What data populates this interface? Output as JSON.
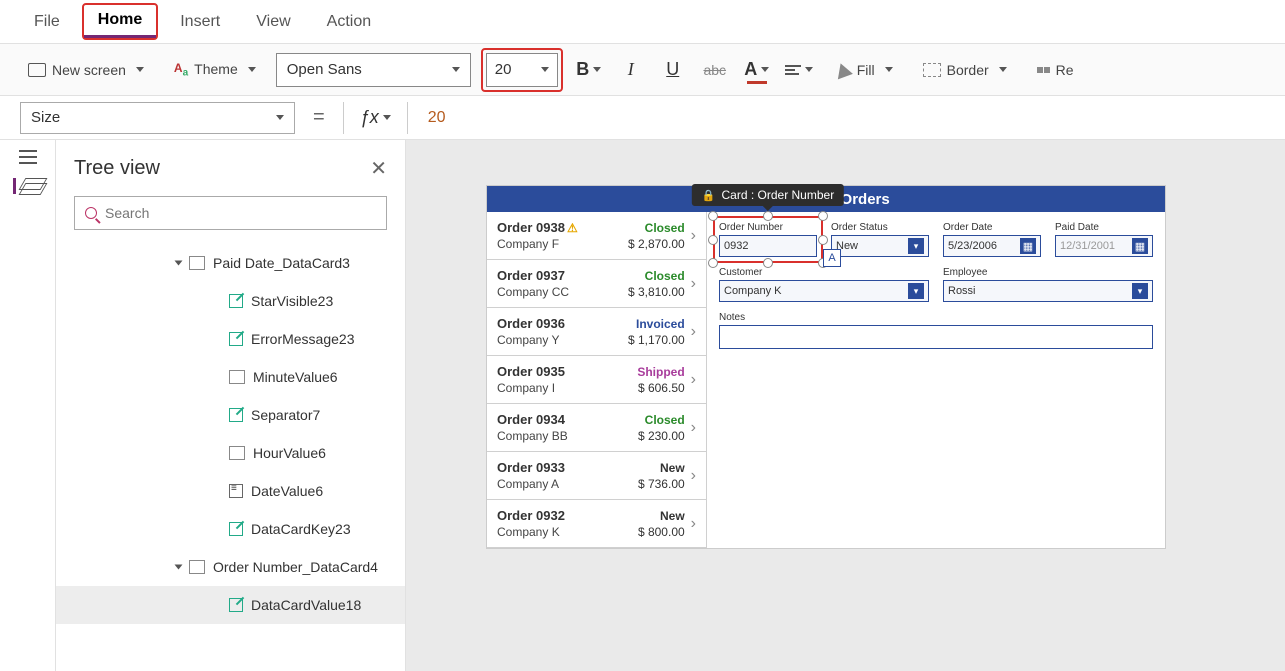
{
  "menu": {
    "items": [
      "File",
      "Home",
      "Insert",
      "View",
      "Action"
    ],
    "active": "Home"
  },
  "ribbon": {
    "new_screen": "New screen",
    "theme": "Theme",
    "font": "Open Sans",
    "size": "20",
    "fill": "Fill",
    "border": "Border",
    "reorder": "Re"
  },
  "formula": {
    "property": "Size",
    "value": "20"
  },
  "tree": {
    "title": "Tree view",
    "search_placeholder": "Search",
    "nodes": [
      {
        "label": "Paid Date_DataCard3",
        "type": "card",
        "level": 0,
        "expanded": true
      },
      {
        "label": "StarVisible23",
        "type": "edit",
        "level": 1
      },
      {
        "label": "ErrorMessage23",
        "type": "edit",
        "level": 1
      },
      {
        "label": "MinuteValue6",
        "type": "input",
        "level": 1
      },
      {
        "label": "Separator7",
        "type": "edit",
        "level": 1
      },
      {
        "label": "HourValue6",
        "type": "input",
        "level": 1
      },
      {
        "label": "DateValue6",
        "type": "cal",
        "level": 1
      },
      {
        "label": "DataCardKey23",
        "type": "edit",
        "level": 1
      },
      {
        "label": "Order Number_DataCard4",
        "type": "card",
        "level": 0,
        "expanded": true
      },
      {
        "label": "DataCardValue18",
        "type": "edit",
        "level": 1,
        "selected": true
      }
    ]
  },
  "canvas": {
    "tooltip": "Card : Order Number",
    "app_title": "Northwind Orders",
    "list": [
      {
        "order": "Order 0938",
        "warn": true,
        "company": "Company F",
        "status": "Closed",
        "status_cls": "closed",
        "amount": "$ 2,870.00"
      },
      {
        "order": "Order 0937",
        "company": "Company CC",
        "status": "Closed",
        "status_cls": "closed",
        "amount": "$ 3,810.00"
      },
      {
        "order": "Order 0936",
        "company": "Company Y",
        "status": "Invoiced",
        "status_cls": "invoiced",
        "amount": "$ 1,170.00"
      },
      {
        "order": "Order 0935",
        "company": "Company I",
        "status": "Shipped",
        "status_cls": "shipped",
        "amount": "$ 606.50"
      },
      {
        "order": "Order 0934",
        "company": "Company BB",
        "status": "Closed",
        "status_cls": "closed",
        "amount": "$ 230.00"
      },
      {
        "order": "Order 0933",
        "company": "Company A",
        "status": "New",
        "status_cls": "new",
        "amount": "$ 736.00"
      },
      {
        "order": "Order 0932",
        "company": "Company K",
        "status": "New",
        "status_cls": "new",
        "amount": "$ 800.00"
      }
    ],
    "form": {
      "order_number": {
        "label": "Order Number",
        "value": "0932"
      },
      "order_status": {
        "label": "Order Status",
        "value": "New"
      },
      "order_date": {
        "label": "Order Date",
        "value": "5/23/2006"
      },
      "paid_date": {
        "label": "Paid Date",
        "value": "12/31/2001"
      },
      "customer": {
        "label": "Customer",
        "value": "Company K"
      },
      "employee": {
        "label": "Employee",
        "value": "Rossi"
      },
      "notes": {
        "label": "Notes"
      }
    }
  }
}
